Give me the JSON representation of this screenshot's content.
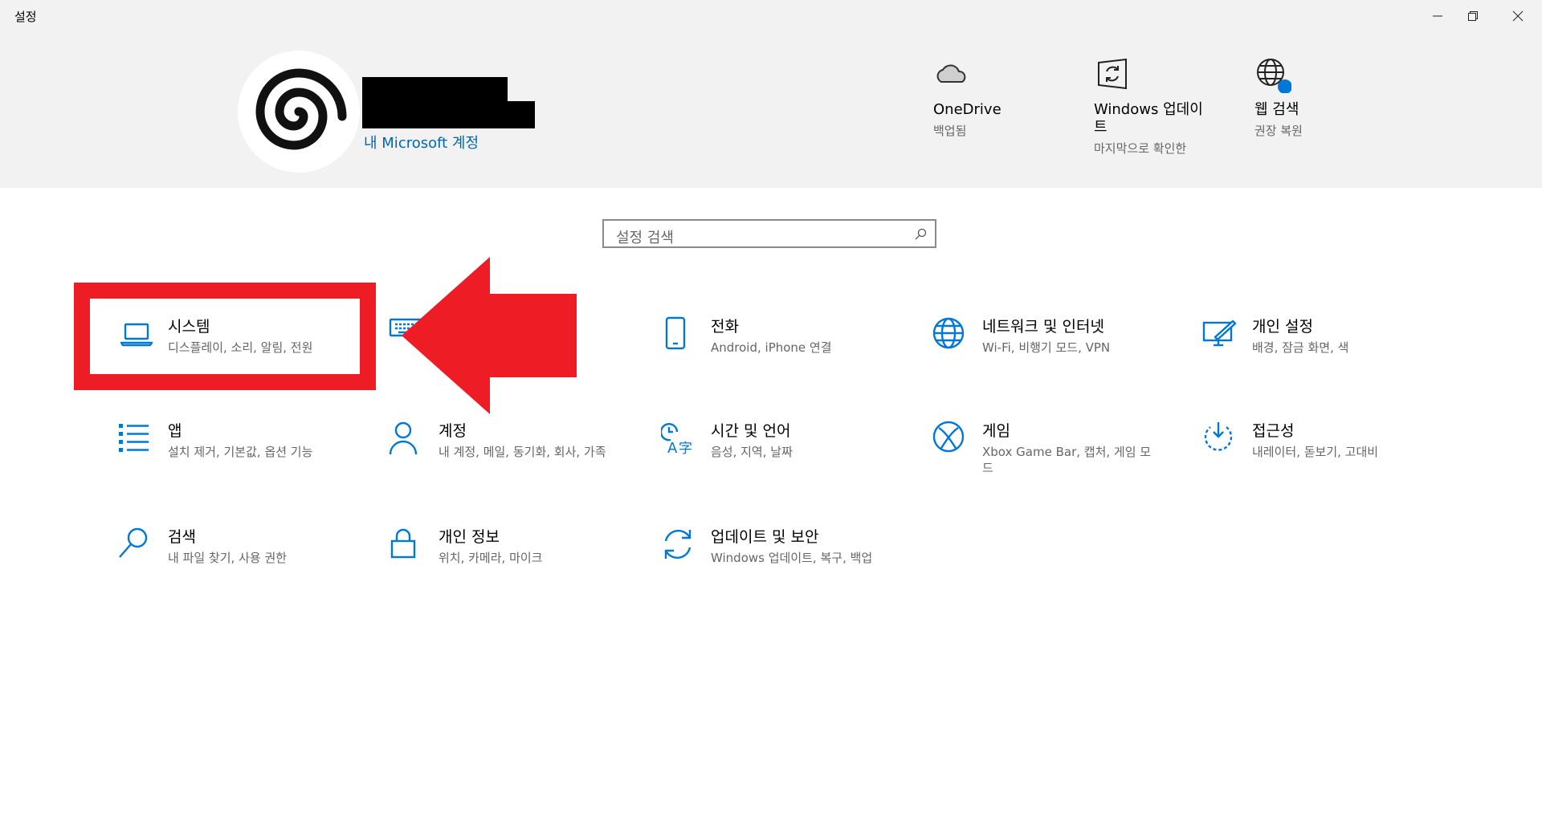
{
  "window": {
    "title": "설정",
    "controls": [
      "minimize-icon",
      "restore-icon",
      "close-icon"
    ]
  },
  "account": {
    "link_label": "내 Microsoft 계정"
  },
  "quick_links": [
    {
      "name": "onedrive",
      "icon": "cloud-icon",
      "title": "OneDrive",
      "subtitle": "백업됨"
    },
    {
      "name": "windows-update",
      "icon": "windows-update-icon",
      "title": "Windows 업데이트",
      "subtitle": "마지막으로 확인한"
    },
    {
      "name": "web-search",
      "icon": "globe-icon",
      "title": "웹 검색",
      "subtitle": "권장 복원"
    }
  ],
  "search": {
    "placeholder": "설정 검색"
  },
  "tiles": [
    {
      "name": "system",
      "icon": "laptop-icon",
      "title": "시스템",
      "subtitle": "디스플레이, 소리, 알림, 전원"
    },
    {
      "name": "devices",
      "icon": "keyboard-icon",
      "title": "",
      "subtitle": ""
    },
    {
      "name": "phone",
      "icon": "phone-icon",
      "title": "전화",
      "subtitle": "Android, iPhone 연결"
    },
    {
      "name": "network",
      "icon": "globe-network-icon",
      "title": "네트워크 및 인터넷",
      "subtitle": "Wi-Fi, 비행기 모드, VPN"
    },
    {
      "name": "personalization",
      "icon": "personalization-icon",
      "title": "개인 설정",
      "subtitle": "배경, 잠금 화면, 색"
    },
    {
      "name": "apps",
      "icon": "apps-list-icon",
      "title": "앱",
      "subtitle": "설치 제거, 기본값, 옵션 기능"
    },
    {
      "name": "accounts",
      "icon": "person-icon",
      "title": "계정",
      "subtitle": "내 계정, 메일, 동기화, 회사, 가족"
    },
    {
      "name": "time-language",
      "icon": "time-language-icon",
      "title": "시간 및 언어",
      "subtitle": "음성, 지역, 날짜"
    },
    {
      "name": "gaming",
      "icon": "xbox-icon",
      "title": "게임",
      "subtitle": "Xbox Game Bar, 캡처, 게임 모드"
    },
    {
      "name": "accessibility",
      "icon": "accessibility-icon",
      "title": "접근성",
      "subtitle": "내레이터, 돋보기, 고대비"
    },
    {
      "name": "search-settings",
      "icon": "search-icon",
      "title": "검색",
      "subtitle": "내 파일 찾기, 사용 권한"
    },
    {
      "name": "privacy",
      "icon": "lock-icon",
      "title": "개인 정보",
      "subtitle": "위치, 카메라, 마이크"
    },
    {
      "name": "update-security",
      "icon": "sync-icon",
      "title": "업데이트 및 보안",
      "subtitle": "Windows 업데이트, 복구, 백업"
    }
  ],
  "colors": {
    "accent": "#0078d7",
    "annotation_red": "#ee1c25",
    "header_bg": "#f2f2f2"
  }
}
